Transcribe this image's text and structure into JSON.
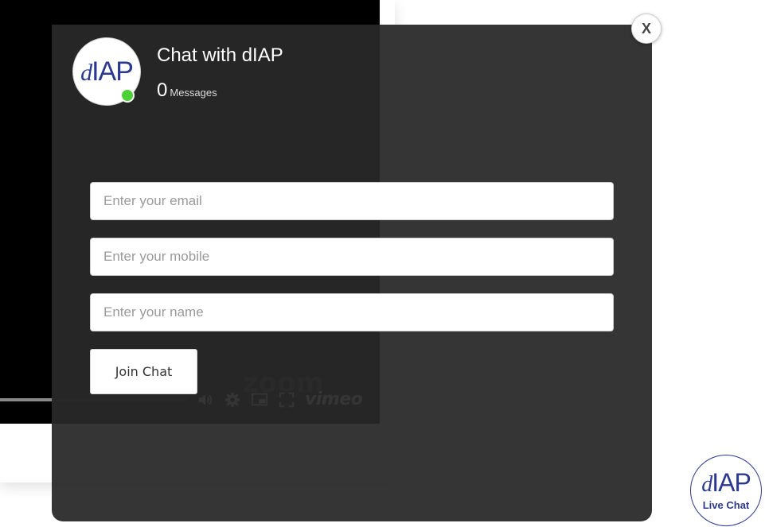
{
  "background_player": {
    "progress": 0.28,
    "watermark": "zoom",
    "vimeo_label": "vimeo",
    "controls": [
      "volume-icon",
      "settings-icon",
      "picture-in-picture-icon",
      "fullscreen-icon"
    ]
  },
  "chat": {
    "logo_italic": "d",
    "logo_rest": "IAP",
    "title": "Chat with dIAP",
    "message_count": "0",
    "messages_label": "Messages",
    "online_color": "#4cd137",
    "close_label": "X"
  },
  "form": {
    "email_placeholder": "Enter your email",
    "mobile_placeholder": "Enter your mobile",
    "name_placeholder": "Enter your name",
    "join_label": "Join Chat"
  },
  "launcher": {
    "logo_italic": "d",
    "logo_rest": "IAP",
    "caption": "Live Chat"
  },
  "colors": {
    "brand": "#2b3990",
    "overlay": "#282828"
  }
}
